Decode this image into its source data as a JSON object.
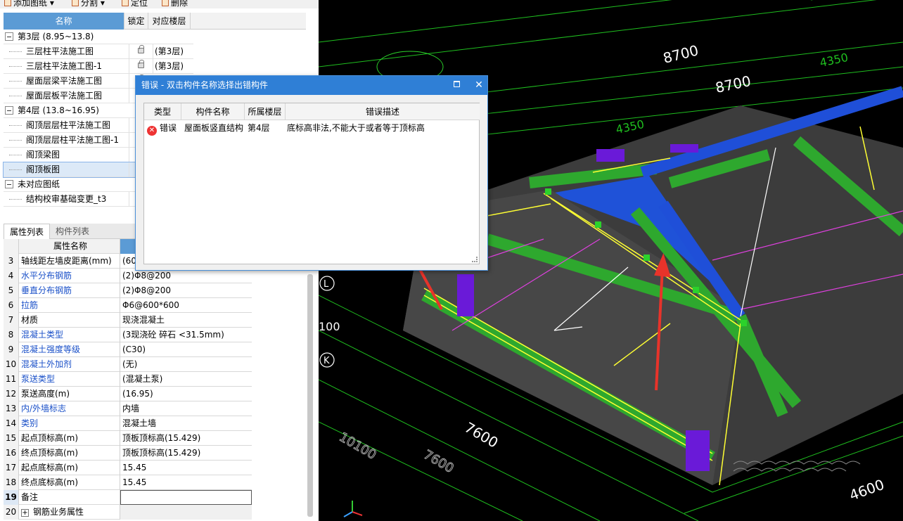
{
  "toolbar": {
    "add_drawing": "添加图纸",
    "split": "分割",
    "locate": "定位",
    "delete": "删除"
  },
  "tree": {
    "headers": {
      "name": "名称",
      "lock": "锁定",
      "floor": "对应楼层"
    },
    "rows": [
      {
        "type": "group",
        "name": "第3层 (8.95~13.8)"
      },
      {
        "type": "item",
        "name": "三层柱平法施工图",
        "floor": "(第3层)"
      },
      {
        "type": "item",
        "name": "三层柱平法施工图-1",
        "floor": "(第3层)"
      },
      {
        "type": "item",
        "name": "屋面层梁平法施工图",
        "floor": ""
      },
      {
        "type": "item",
        "name": "屋面层板平法施工图",
        "floor": ""
      },
      {
        "type": "group",
        "name": "第4层 (13.8~16.95)"
      },
      {
        "type": "item",
        "name": "阁顶层层柱平法施工图",
        "floor": ""
      },
      {
        "type": "item",
        "name": "阁顶层层柱平法施工图-1",
        "floor": ""
      },
      {
        "type": "item",
        "name": "阁顶梁图",
        "floor": ""
      },
      {
        "type": "item",
        "name": "阁顶板图",
        "floor": "",
        "selected": true
      },
      {
        "type": "group",
        "name": "未对应图纸"
      },
      {
        "type": "item",
        "name": "结构校审基础变更_t3",
        "floor": ""
      }
    ]
  },
  "tabs": {
    "properties": "属性列表",
    "components": "构件列表"
  },
  "props": {
    "header": "属性名称",
    "rows": [
      {
        "n": "3",
        "k": "轴线距左墙皮距离(mm)",
        "v": "(60",
        "blue": false
      },
      {
        "n": "4",
        "k": "水平分布钢筋",
        "v": "(2)Φ8@200",
        "blue": true
      },
      {
        "n": "5",
        "k": "垂直分布钢筋",
        "v": "(2)Φ8@200",
        "blue": true
      },
      {
        "n": "6",
        "k": "拉筋",
        "v": "Φ6@600*600",
        "blue": true
      },
      {
        "n": "7",
        "k": "材质",
        "v": "现浇混凝土",
        "blue": false
      },
      {
        "n": "8",
        "k": "混凝土类型",
        "v": "(3现浇砼 碎石 <31.5mm)",
        "blue": true
      },
      {
        "n": "9",
        "k": "混凝土强度等级",
        "v": "(C30)",
        "blue": true
      },
      {
        "n": "10",
        "k": "混凝土外加剂",
        "v": "(无)",
        "blue": true
      },
      {
        "n": "11",
        "k": "泵送类型",
        "v": "(混凝土泵)",
        "blue": true
      },
      {
        "n": "12",
        "k": "泵送高度(m)",
        "v": "(16.95)",
        "blue": false
      },
      {
        "n": "13",
        "k": "内/外墙标志",
        "v": "内墙",
        "blue": true
      },
      {
        "n": "14",
        "k": "类别",
        "v": "混凝土墙",
        "blue": true
      },
      {
        "n": "15",
        "k": "起点顶标高(m)",
        "v": "顶板顶标高(15.429)",
        "blue": false
      },
      {
        "n": "16",
        "k": "终点顶标高(m)",
        "v": "顶板顶标高(15.429)",
        "blue": false
      },
      {
        "n": "17",
        "k": "起点底标高(m)",
        "v": "15.45",
        "blue": false
      },
      {
        "n": "18",
        "k": "终点底标高(m)",
        "v": "15.45",
        "blue": false
      },
      {
        "n": "19",
        "k": "备注",
        "v": "",
        "blue": false
      },
      {
        "n": "20",
        "k": "钢筋业务属性",
        "v": "",
        "blue": false
      }
    ]
  },
  "dialog": {
    "title": "错误 - 双击构件名称选择出错构件",
    "headers": {
      "type": "类型",
      "component": "构件名称",
      "floor": "所属楼层",
      "desc": "错误描述"
    },
    "row": {
      "type": "错误",
      "component": "屋面板竖直结构",
      "floor": "第4层",
      "desc": "底标高非法,不能大于或者等于顶标高"
    }
  },
  "canvas": {
    "dims": [
      "8700",
      "8700",
      "4350",
      "4350",
      "7600",
      "7600",
      "10100",
      "4600",
      "100"
    ],
    "axis_labels": [
      "L",
      "K"
    ],
    "colors": {
      "beam": "#2ea82e",
      "slab": "#3e3e3e",
      "wall": "#1f4fd8",
      "column": "#6a1ad8",
      "dim": "#2bd22b",
      "annot": "#e63b2e"
    }
  }
}
